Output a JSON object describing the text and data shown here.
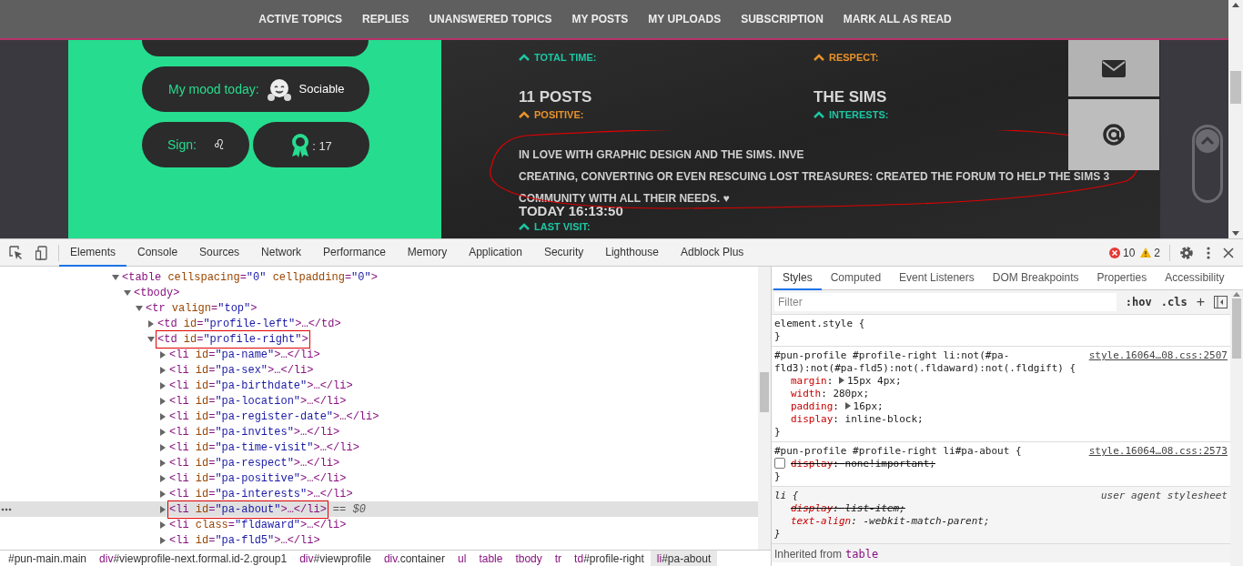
{
  "nav": [
    "ACTIVE TOPICS",
    "REPLIES",
    "UNANSWERED TOPICS",
    "MY POSTS",
    "MY UPLOADS",
    "SUBSCRIPTION",
    "MARK ALL AS READ"
  ],
  "profile_left": {
    "mood_label": "My mood today:",
    "mood": "Sociable",
    "sign_label": "Sign:",
    "sign": "♌",
    "awards": ": 17"
  },
  "stats": [
    {
      "label": "TOTAL TIME:",
      "color": "#1cc7a3"
    },
    {
      "label": "RESPECT:",
      "color": "#e8922a"
    },
    {
      "value": "11 POSTS",
      "label": "POSITIVE:",
      "color": "#e8922a"
    },
    {
      "value": "THE SIMS",
      "label": "INTERESTS:",
      "color": "#1cc7a3"
    }
  ],
  "about": {
    "annotated": true,
    "lines": [
      "IN LOVE WITH GRAPHIC DESIGN AND THE SIMS. INVE",
      "CREATING, CONVERTING OR EVEN RESCUING LOST TREASURES: CREATED THE FORUM TO HELP THE SIMS 3",
      "COMMUNITY WITH ALL THEIR NEEDS. ♥"
    ]
  },
  "last_visit": {
    "value": "TODAY 16:13:50",
    "label": "LAST VISIT:",
    "color": "#1cc7a3"
  },
  "devtools": {
    "tabs": [
      {
        "label": "Elements",
        "selected": true
      },
      {
        "label": "Console",
        "selected": false
      },
      {
        "label": "Sources",
        "selected": false
      },
      {
        "label": "Network",
        "selected": false
      },
      {
        "label": "Performance",
        "selected": false
      },
      {
        "label": "Memory",
        "selected": false
      },
      {
        "label": "Application",
        "selected": false
      },
      {
        "label": "Security",
        "selected": false
      },
      {
        "label": "Lighthouse",
        "selected": false
      },
      {
        "label": "Adblock Plus",
        "selected": false
      }
    ],
    "errors": "10",
    "warnings": "2",
    "tree": [
      {
        "text": "<table cellspacing=\"0\" cellpadding=\"0\">",
        "expanded": true,
        "selected": false,
        "annotated": false,
        "children": [
          {
            "text": "<tbody>",
            "expanded": true,
            "selected": false,
            "annotated": false,
            "children": [
              {
                "text": "<tr valign=\"top\">",
                "expanded": true,
                "selected": false,
                "annotated": false,
                "children": [
                  {
                    "text": "<td id=\"profile-left\">…</td>",
                    "expanded": false,
                    "selected": false,
                    "annotated": false
                  },
                  {
                    "text": "<td id=\"profile-right\">",
                    "expanded": true,
                    "selected": false,
                    "annotated": true,
                    "children": [
                      {
                        "text": "<li id=\"pa-name\">…</li>",
                        "expanded": false,
                        "selected": false,
                        "annotated": false
                      },
                      {
                        "text": "<li id=\"pa-sex\">…</li>",
                        "expanded": false,
                        "selected": false,
                        "annotated": false
                      },
                      {
                        "text": "<li id=\"pa-birthdate\">…</li>",
                        "expanded": false,
                        "selected": false,
                        "annotated": false
                      },
                      {
                        "text": "<li id=\"pa-location\">…</li>",
                        "expanded": false,
                        "selected": false,
                        "annotated": false
                      },
                      {
                        "text": "<li id=\"pa-register-date\">…</li>",
                        "expanded": false,
                        "selected": false,
                        "annotated": false
                      },
                      {
                        "text": "<li id=\"pa-invites\">…</li>",
                        "expanded": false,
                        "selected": false,
                        "annotated": false
                      },
                      {
                        "text": "<li id=\"pa-time-visit\">…</li>",
                        "expanded": false,
                        "selected": false,
                        "annotated": false
                      },
                      {
                        "text": "<li id=\"pa-respect\">…</li>",
                        "expanded": false,
                        "selected": false,
                        "annotated": false
                      },
                      {
                        "text": "<li id=\"pa-positive\">…</li>",
                        "expanded": false,
                        "selected": false,
                        "annotated": false
                      },
                      {
                        "text": "<li id=\"pa-interests\">…</li>",
                        "expanded": false,
                        "selected": false,
                        "annotated": false
                      },
                      {
                        "text": "<li id=\"pa-about\">…</li>",
                        "suffix": "== $0",
                        "expanded": false,
                        "selected": true,
                        "annotated": true
                      },
                      {
                        "text": "<li class=\"fldaward\">…</li>",
                        "expanded": false,
                        "selected": false,
                        "annotated": false
                      },
                      {
                        "text": "<li id=\"pa-fld5\">…</li>",
                        "expanded": false,
                        "selected": false,
                        "annotated": false
                      }
                    ]
                  }
                ]
              }
            ]
          }
        ]
      }
    ],
    "breadcrumbs": [
      {
        "label": "#pun-main.main",
        "selected": false
      },
      {
        "label": "div#viewprofile-next.formal.id-2.group1",
        "selected": false
      },
      {
        "label": "div#viewprofile",
        "selected": false
      },
      {
        "label": "div.container",
        "selected": false
      },
      {
        "label": "ul",
        "selected": false
      },
      {
        "label": "table",
        "selected": false
      },
      {
        "label": "tbody",
        "selected": false
      },
      {
        "label": "tr",
        "selected": false
      },
      {
        "label": "td#profile-right",
        "selected": false
      },
      {
        "label": "li#pa-about",
        "selected": true
      }
    ],
    "side_tabs": [
      {
        "label": "Styles",
        "selected": true
      },
      {
        "label": "Computed",
        "selected": false
      },
      {
        "label": "Event Listeners",
        "selected": false
      },
      {
        "label": "DOM Breakpoints",
        "selected": false
      },
      {
        "label": "Properties",
        "selected": false
      },
      {
        "label": "Accessibility",
        "selected": false
      }
    ],
    "filter": {
      "placeholder": "Filter"
    },
    "hov": ":hov",
    "cls": ".cls",
    "plus": "+",
    "rules": [
      {
        "kind": "author",
        "selector": "element.style {",
        "close": "}"
      },
      {
        "kind": "author",
        "selector": "#pun-profile #profile-right li:not(#pa-fld3):not(#pa-fld5):not(.fldaward):not(.fldgift) {",
        "source": "style.16064…08.css:2507",
        "close": "}",
        "properties": [
          {
            "name": "margin",
            "sep": ":",
            "value": "15px 4px;",
            "expandable": true,
            "struck": false
          },
          {
            "name": "width",
            "sep": ":",
            "value": "280px;",
            "expandable": false,
            "struck": false
          },
          {
            "name": "padding",
            "sep": ":",
            "value": "16px;",
            "expandable": true,
            "struck": false
          },
          {
            "name": "display",
            "sep": ":",
            "value": "inline-block;",
            "expandable": false,
            "struck": false
          }
        ]
      },
      {
        "kind": "author",
        "selector": "#pun-profile #profile-right li#pa-about {",
        "source": "style.16064…08.css:2573",
        "close": "}",
        "properties": [
          {
            "name": "display",
            "sep": ":",
            "value": "none!important;",
            "expandable": false,
            "struck": true,
            "checked": false
          }
        ]
      },
      {
        "kind": "ua",
        "selector": "li {",
        "source": "user agent stylesheet",
        "close": "}",
        "properties": [
          {
            "name": "display",
            "sep": ":",
            "value": "list-item;",
            "expandable": false,
            "struck": true
          },
          {
            "name": "text-align",
            "sep": ":",
            "value": "-webkit-match-parent;",
            "expandable": false,
            "struck": false
          }
        ]
      }
    ],
    "inherited": {
      "label": "Inherited from",
      "element": "table"
    }
  }
}
